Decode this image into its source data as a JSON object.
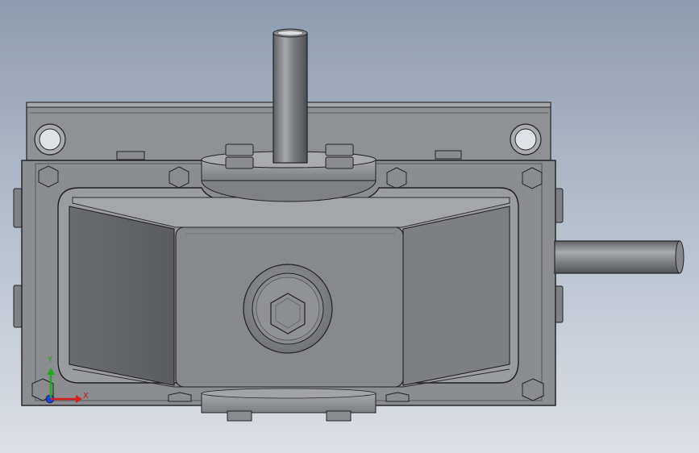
{
  "triad": {
    "x_label": "X",
    "y_label": "Y",
    "colors": {
      "x": "#d81e1e",
      "y": "#1eaa1e",
      "z": "#1e3cd8"
    }
  },
  "model": {
    "icons": [
      "gearbox-housing-model",
      "hex-bolt-icon",
      "shaft-icon",
      "mounting-hole-icon"
    ]
  }
}
